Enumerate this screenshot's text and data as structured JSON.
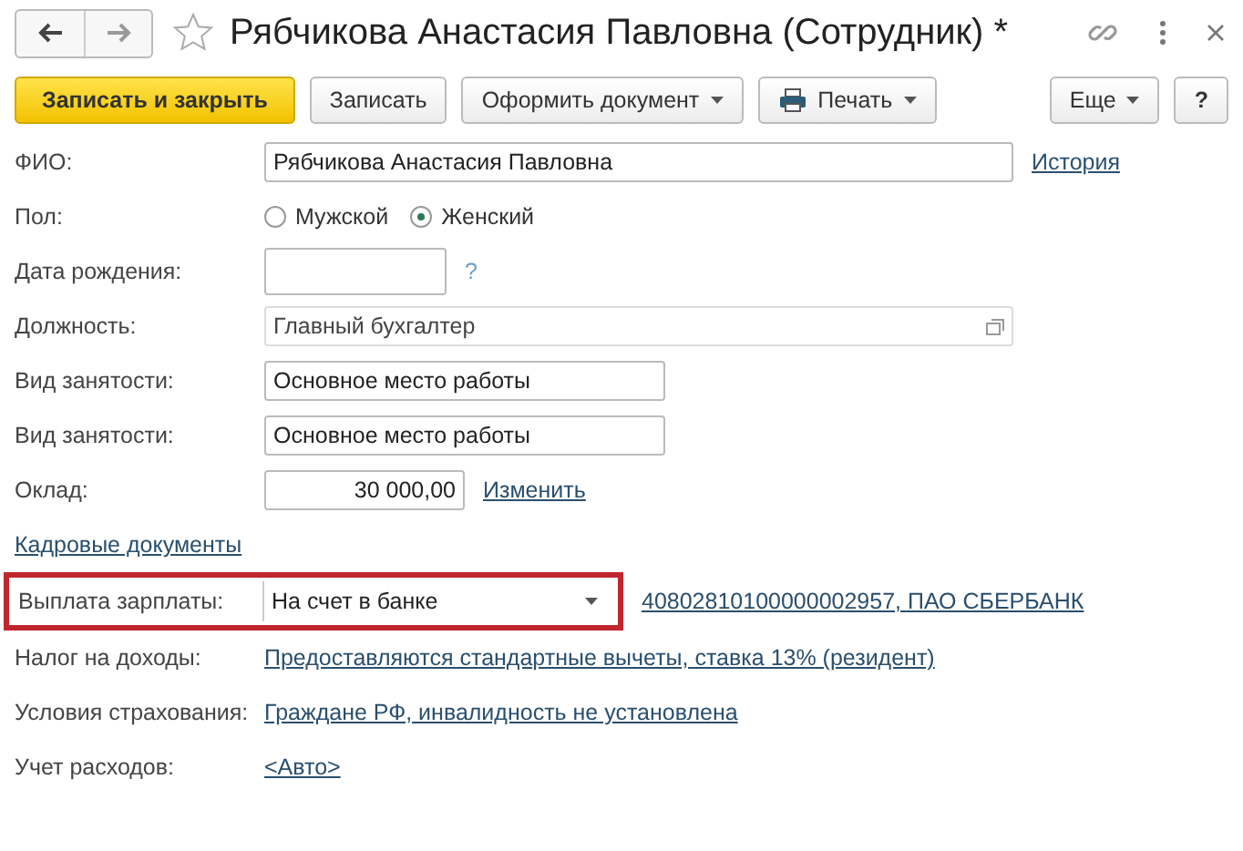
{
  "window": {
    "title": "Рябчикова Анастасия Павловна (Сотрудник) *",
    "favorite": false
  },
  "toolbar": [
    {
      "label": "Записать и закрыть",
      "kind": "primary"
    },
    {
      "label": "Записать",
      "kind": "plain"
    },
    {
      "label": "Оформить документ",
      "kind": "menu"
    },
    {
      "label": "Печать",
      "kind": "print"
    },
    {
      "label": "Еще",
      "kind": "menu"
    },
    {
      "label": "?",
      "kind": "help"
    }
  ],
  "fields": [
    {
      "kind": "text-wide",
      "label": "ФИО:",
      "value": "Рябчикова Анастасия Павловна",
      "link": "История"
    },
    {
      "kind": "radio",
      "label": "Пол:",
      "options": [
        {
          "label": "Мужской",
          "selected": false
        },
        {
          "label": "Женский",
          "selected": true
        }
      ]
    },
    {
      "kind": "date",
      "label": "Дата рождения:",
      "link": "?"
    },
    {
      "kind": "pick",
      "label": "Должность:",
      "value": "Главный бухгалтер"
    },
    {
      "kind": "text",
      "label": "Вид занятости:",
      "value": "Основное место работы"
    },
    {
      "kind": "text",
      "label": "Вид занятости:",
      "value": "Основное место работы"
    },
    {
      "kind": "number",
      "label": "Оклад:",
      "value": "30 000,00",
      "link": "Изменить"
    },
    {
      "kind": "link-only",
      "link": "Кадровые документы"
    },
    {
      "kind": "combo",
      "label": "Выплата зарплаты:",
      "value": "На счет в банке",
      "highlighted": true,
      "link": "40802810100000002957, ПАО СБЕРБАНК"
    },
    {
      "kind": "link-value",
      "label": "Налог на доходы:",
      "link": "Предоставляются стандартные вычеты, ставка 13% (резидент)"
    },
    {
      "kind": "link-value",
      "label": "Условия страхования:",
      "link": "Граждане РФ, инвалидность не установлена"
    },
    {
      "kind": "link-value",
      "label": "Учет расходов:",
      "link": "<Авто>"
    }
  ]
}
